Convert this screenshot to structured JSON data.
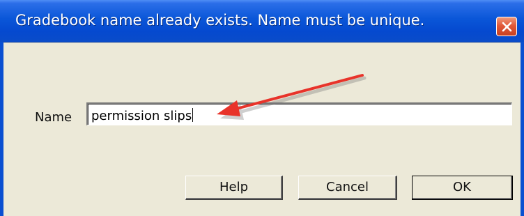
{
  "dialog": {
    "title": "Gradebook name already exists. Name must be unique.",
    "close_icon": "close-icon"
  },
  "form": {
    "name_label": "Name",
    "name_value": "permission slips"
  },
  "buttons": {
    "help": "Help",
    "cancel": "Cancel",
    "ok": "OK"
  },
  "annotation": {
    "arrow_color": "#e8332a"
  },
  "colors": {
    "titlebar": "#0a56d8",
    "dialog_bg": "#ece9d8",
    "close_button": "#e2593a"
  }
}
